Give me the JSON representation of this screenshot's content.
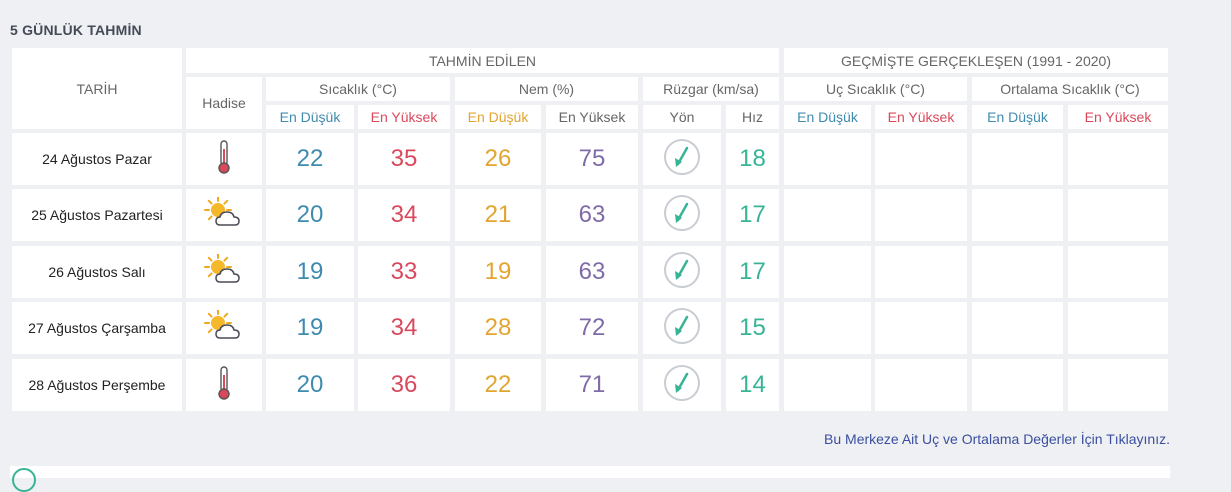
{
  "section_title": "5 GÜNLÜK TAHMİN",
  "headers": {
    "date": "TARİH",
    "forecast_group": "TAHMİN EDİLEN",
    "past_group": "GEÇMİŞTE GERÇEKLEŞEN (1991 - 2020)",
    "event": "Hadise",
    "temperature": "Sıcaklık (°C)",
    "humidity": "Nem (%)",
    "wind": "Rüzgar (km/sa)",
    "extreme_temp": "Uç Sıcaklık (°C)",
    "average_temp": "Ortalama Sıcaklık (°C)",
    "low": "En Düşük",
    "high": "En Yüksek",
    "direction": "Yön",
    "speed": "Hız"
  },
  "colors": {
    "low": "#3f8bb0",
    "high": "#d9495c",
    "humidity_low": "#e2a531",
    "humidity_high": "#7f6ba8",
    "wind_speed": "#37b496"
  },
  "days": [
    {
      "date": "24 Ağustos Pazar",
      "icon": "thermometer-icon",
      "temp_low": "22",
      "temp_high": "35",
      "hum_low": "26",
      "hum_high": "75",
      "wind_dir": "north-east-arrow",
      "wind_speed": "18"
    },
    {
      "date": "25 Ağustos Pazartesi",
      "icon": "partly-cloudy-icon",
      "temp_low": "20",
      "temp_high": "34",
      "hum_low": "21",
      "hum_high": "63",
      "wind_dir": "north-east-arrow",
      "wind_speed": "17"
    },
    {
      "date": "26 Ağustos Salı",
      "icon": "partly-cloudy-icon",
      "temp_low": "19",
      "temp_high": "33",
      "hum_low": "19",
      "hum_high": "63",
      "wind_dir": "north-east-arrow",
      "wind_speed": "17"
    },
    {
      "date": "27 Ağustos Çarşamba",
      "icon": "partly-cloudy-icon",
      "temp_low": "19",
      "temp_high": "34",
      "hum_low": "28",
      "hum_high": "72",
      "wind_dir": "north-east-arrow",
      "wind_speed": "15"
    },
    {
      "date": "28 Ağustos Perşembe",
      "icon": "thermometer-icon",
      "temp_low": "20",
      "temp_high": "36",
      "hum_low": "22",
      "hum_high": "71",
      "wind_dir": "north-east-arrow",
      "wind_speed": "14"
    }
  ],
  "link_text": "Bu Merkeze Ait Uç ve Ortalama Değerler İçin Tıklayınız."
}
